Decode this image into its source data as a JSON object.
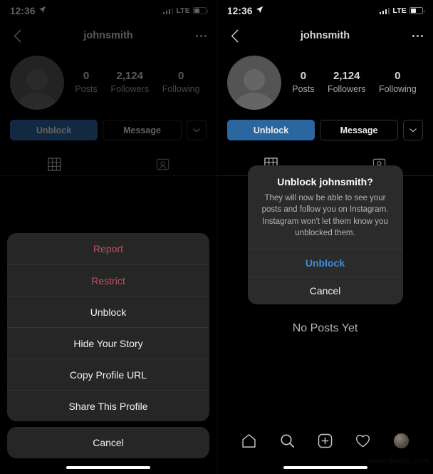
{
  "status_bar": {
    "time": "12:36",
    "location_icon": "location-arrow-icon",
    "signal_icon": "signal-bars-icon",
    "network": "LTE",
    "battery_icon": "battery-icon"
  },
  "nav": {
    "back_icon": "chevron-left-icon",
    "title": "johnsmith",
    "more_icon": "ellipsis-icon"
  },
  "profile": {
    "avatar_icon": "default-avatar-icon",
    "stats": [
      {
        "value": "0",
        "label": "Posts"
      },
      {
        "value": "2,124",
        "label": "Followers"
      },
      {
        "value": "0",
        "label": "Following"
      }
    ]
  },
  "action_buttons": {
    "unblock": "Unblock",
    "message": "Message",
    "caret_icon": "chevron-down-icon"
  },
  "tabs": [
    {
      "name": "grid-tab",
      "icon": "grid-icon",
      "active": true
    },
    {
      "name": "tagged-tab",
      "icon": "tagged-person-icon",
      "active": false
    }
  ],
  "action_sheet": {
    "items": [
      {
        "label": "Report",
        "style": "danger"
      },
      {
        "label": "Restrict",
        "style": "danger"
      },
      {
        "label": "Unblock",
        "style": "default"
      },
      {
        "label": "Hide Your Story",
        "style": "default"
      },
      {
        "label": "Copy Profile URL",
        "style": "default"
      },
      {
        "label": "Share This Profile",
        "style": "default"
      }
    ],
    "cancel": "Cancel"
  },
  "alert": {
    "title": "Unblock johnsmith?",
    "message": "They will now be able to see your posts and follow you on Instagram. Instagram won't let them know you unblocked them.",
    "confirm": "Unblock",
    "cancel": "Cancel"
  },
  "empty_state": {
    "text": "No Posts Yet"
  },
  "bottom_nav": [
    {
      "name": "home-icon"
    },
    {
      "name": "search-icon"
    },
    {
      "name": "add-post-icon"
    },
    {
      "name": "activity-heart-icon"
    },
    {
      "name": "profile-avatar-icon"
    }
  ],
  "watermark": {
    "text": "www.deuzq.com"
  },
  "colors": {
    "accent_blue": "#2e6fad",
    "alert_blue": "#3b8ee0",
    "danger_red": "#c0535d",
    "sheet_bg": "#262626",
    "alert_bg": "#2b2b2b",
    "background": "#000000"
  }
}
